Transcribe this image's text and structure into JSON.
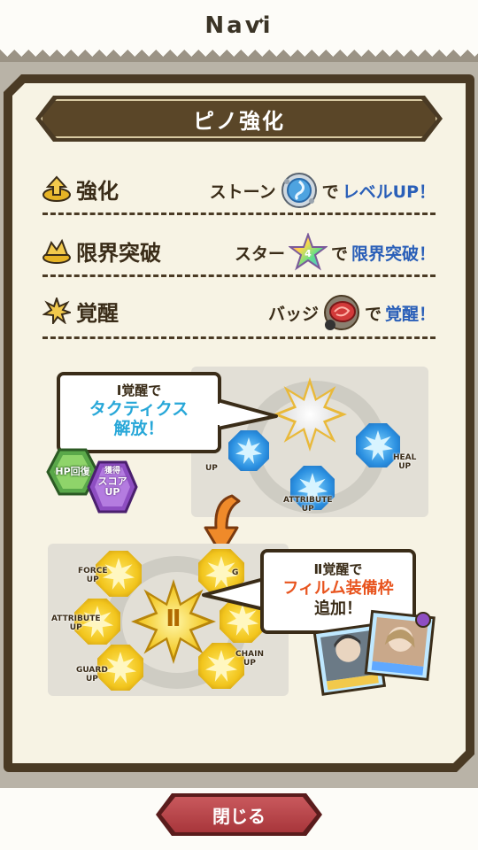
{
  "header": {
    "title": "Navi"
  },
  "banner": {
    "title": "ピノ強化"
  },
  "rows": [
    {
      "name": "強化",
      "icon": "up-arrow-icon",
      "prefix": "ストーン",
      "material": "stone-icon",
      "suffix_dark": "で",
      "suffix_blue": "レベルUP！"
    },
    {
      "name": "限界突破",
      "icon": "limit-break-icon",
      "prefix": "スター",
      "material": "star-icon",
      "suffix_dark": "で",
      "suffix_blue": "限界突破！"
    },
    {
      "name": "覚醒",
      "icon": "awaken-burst-icon",
      "prefix": "バッジ",
      "material": "badge-icon",
      "suffix_dark": "で",
      "suffix_blue": "覚醒！"
    }
  ],
  "diagram1": {
    "bubble_line1": "Ⅰ覚醒で",
    "bubble_line2": "タクティクス",
    "bubble_line3": "解放！",
    "badge_hp": "HP回復",
    "badge_score_top": "獲得",
    "badge_score_mid": "スコア",
    "badge_score_bottom": "UP",
    "node_labels": {
      "left": "UP",
      "bottom": "ATTRIBUTE\nUP",
      "right": "HEAL\nUP"
    }
  },
  "diagram2": {
    "bubble_line1": "Ⅱ覚醒で",
    "bubble_line2": "フィルム装備枠",
    "bubble_line3": "追加！",
    "center_numeral": "Ⅱ",
    "node_labels": {
      "force": "FORCE\nUP",
      "attribute": "ATTRIBUTE\nUP",
      "guard": "GUARD\nUP",
      "chain": "CHAIN\nUP",
      "top_right": "G"
    }
  },
  "close_button": {
    "label": "閉じる"
  },
  "colors": {
    "panel_border": "#4a3a24",
    "panel_fill": "#f7f3e4",
    "accent_blue": "#2a5fb8",
    "accent_cyan": "#27a7d8",
    "accent_orange": "#e8541e",
    "button_red": "#b8434a"
  }
}
